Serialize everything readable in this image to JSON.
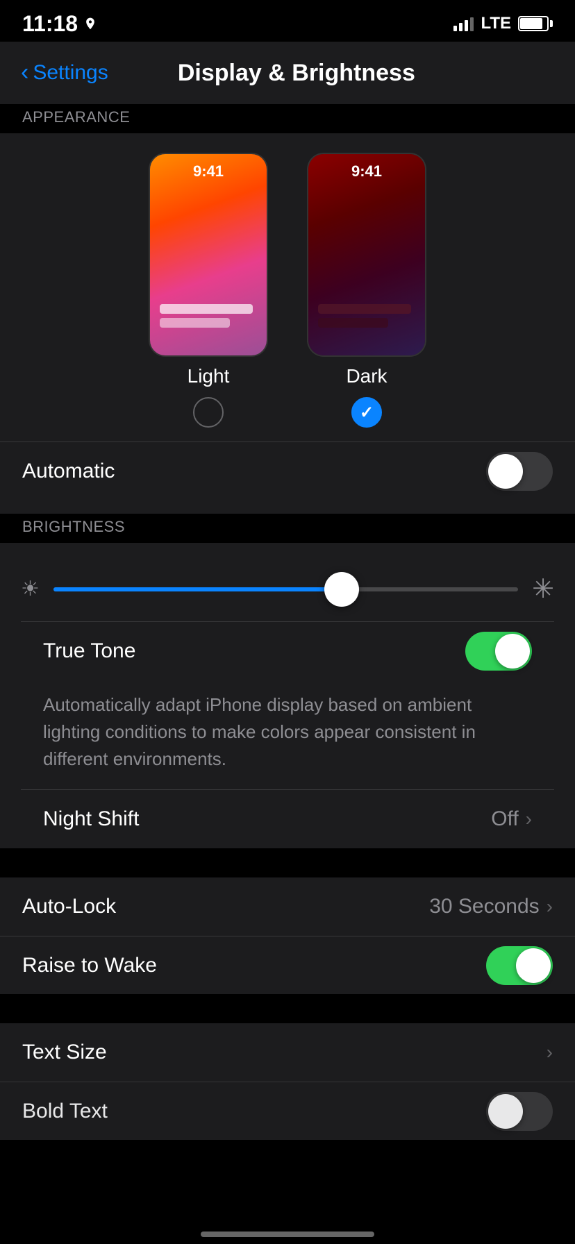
{
  "statusBar": {
    "time": "11:18",
    "lte": "LTE"
  },
  "navBar": {
    "backLabel": "Settings",
    "title": "Display & Brightness"
  },
  "appearance": {
    "sectionLabel": "APPEARANCE",
    "lightOption": {
      "time": "9:41",
      "label": "Light"
    },
    "darkOption": {
      "time": "9:41",
      "label": "Dark"
    },
    "automaticLabel": "Automatic"
  },
  "brightness": {
    "sectionLabel": "BRIGHTNESS",
    "trueToneLabel": "True Tone",
    "trueToneDescription": "Automatically adapt iPhone display based on ambient lighting conditions to make colors appear consistent in different environments.",
    "nightShiftLabel": "Night Shift",
    "nightShiftValue": "Off"
  },
  "autoLock": {
    "label": "Auto-Lock",
    "value": "30 Seconds"
  },
  "raiseToWake": {
    "label": "Raise to Wake"
  },
  "textSize": {
    "label": "Text Size"
  },
  "boldText": {
    "label": "Bold Text"
  }
}
